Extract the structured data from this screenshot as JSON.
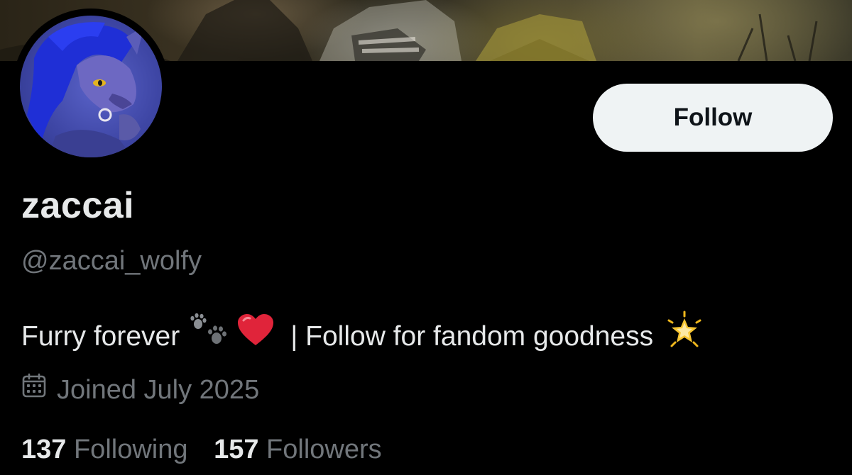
{
  "profile": {
    "display_name": "zaccai",
    "handle": "@zaccai_wolfy",
    "bio": {
      "text_before": "Furry forever",
      "text_after": "| Follow for fandom goodness",
      "emojis": [
        "paw-prints-emoji",
        "red-heart-emoji",
        "glowing-star-emoji"
      ]
    },
    "joined": "Joined July 2025",
    "following_count": "137",
    "following_label": "Following",
    "followers_count": "157",
    "followers_label": "Followers"
  },
  "actions": {
    "follow_label": "Follow"
  },
  "icons": {
    "calendar": "calendar-icon"
  },
  "colors": {
    "background": "#000000",
    "primary_text": "#e7e9ea",
    "secondary_text": "#71767b",
    "follow_button_bg": "#eff3f4",
    "follow_button_text": "#0f1419",
    "heart": "#e0243a",
    "avatar_fur": "#3f47a6"
  }
}
